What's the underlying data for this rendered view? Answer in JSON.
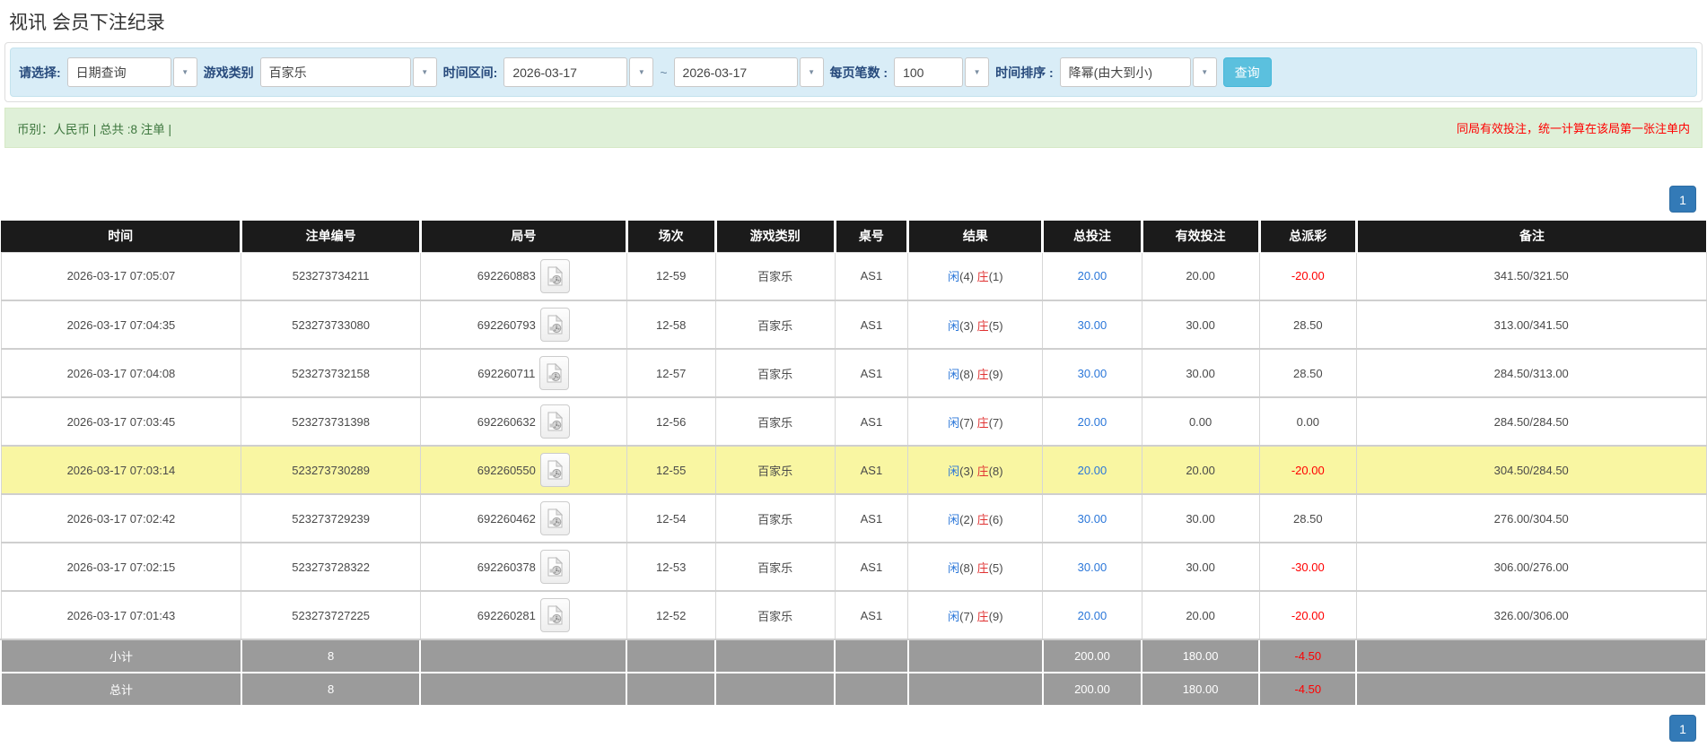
{
  "page": {
    "title": "视讯 会员下注纪录"
  },
  "filters": {
    "select_label": "请选择:",
    "select_value": "日期查询",
    "game_label": "游戏类别",
    "game_value": "百家乐",
    "range_label": "时间区间:",
    "date_from": "2026-03-17",
    "tilde": "~",
    "date_to": "2026-03-17",
    "page_size_label": "每页笔数 :",
    "page_size_value": "100",
    "sort_label": "时间排序 :",
    "sort_value": "降幂(由大到小)",
    "search_button": "查询"
  },
  "summary": {
    "left": "币别：人民币 | 总共 :8 注单 |",
    "right": "同局有效投注，统一计算在该局第一张注单内"
  },
  "pagination": {
    "page": "1"
  },
  "colors": {
    "accent_blue": "#337ab7",
    "link_blue": "#2b77d9",
    "player_blue": "#2b77d9",
    "banker_red": "#e03333",
    "negative_red": "#ff0000",
    "highlight_yellow": "#f9f6a2",
    "filter_bar_bg": "#d9edf7",
    "summary_bar_bg": "#dff0d8",
    "summary_text_green": "#3c763d",
    "table_header_bg": "#1b1b1b",
    "summary_row_gray": "#9b9b9b",
    "search_button_bg": "#5bc0de"
  },
  "icons": {
    "combo_caret": "▼",
    "video_icon": "film-file-icon"
  },
  "table": {
    "headers": [
      "时间",
      "注单编号",
      "局号",
      "场次",
      "游戏类别",
      "桌号",
      "结果",
      "总投注",
      "有效投注",
      "总派彩",
      "备注"
    ],
    "col_widths": [
      "14.1%",
      "10.5%",
      "12.1%",
      "5.2%",
      "7.0%",
      "4.3%",
      "7.9%",
      "5.8%",
      "6.9%",
      "5.7%",
      "20.5%"
    ],
    "rows": [
      {
        "time": "2026-03-17 07:05:07",
        "bet_id": "523273734211",
        "round_id": "692260883",
        "session": "12-59",
        "game": "百家乐",
        "table_no": "AS1",
        "result": {
          "player": "闲(4)",
          "banker": "庄(1)"
        },
        "total_bet": "20.00",
        "valid_bet": "20.00",
        "payout": "-20.00",
        "remark": "341.50/321.50",
        "highlight": false
      },
      {
        "time": "2026-03-17 07:04:35",
        "bet_id": "523273733080",
        "round_id": "692260793",
        "session": "12-58",
        "game": "百家乐",
        "table_no": "AS1",
        "result": {
          "player": "闲(3)",
          "banker": "庄(5)"
        },
        "total_bet": "30.00",
        "valid_bet": "30.00",
        "payout": "28.50",
        "remark": "313.00/341.50",
        "highlight": false
      },
      {
        "time": "2026-03-17 07:04:08",
        "bet_id": "523273732158",
        "round_id": "692260711",
        "session": "12-57",
        "game": "百家乐",
        "table_no": "AS1",
        "result": {
          "player": "闲(8)",
          "banker": "庄(9)"
        },
        "total_bet": "30.00",
        "valid_bet": "30.00",
        "payout": "28.50",
        "remark": "284.50/313.00",
        "highlight": false
      },
      {
        "time": "2026-03-17 07:03:45",
        "bet_id": "523273731398",
        "round_id": "692260632",
        "session": "12-56",
        "game": "百家乐",
        "table_no": "AS1",
        "result": {
          "player": "闲(7)",
          "banker": "庄(7)"
        },
        "total_bet": "20.00",
        "valid_bet": "0.00",
        "payout": "0.00",
        "remark": "284.50/284.50",
        "highlight": false
      },
      {
        "time": "2026-03-17 07:03:14",
        "bet_id": "523273730289",
        "round_id": "692260550",
        "session": "12-55",
        "game": "百家乐",
        "table_no": "AS1",
        "result": {
          "player": "闲(3)",
          "banker": "庄(8)"
        },
        "total_bet": "20.00",
        "valid_bet": "20.00",
        "payout": "-20.00",
        "remark": "304.50/284.50",
        "highlight": true
      },
      {
        "time": "2026-03-17 07:02:42",
        "bet_id": "523273729239",
        "round_id": "692260462",
        "session": "12-54",
        "game": "百家乐",
        "table_no": "AS1",
        "result": {
          "player": "闲(2)",
          "banker": "庄(6)"
        },
        "total_bet": "30.00",
        "valid_bet": "30.00",
        "payout": "28.50",
        "remark": "276.00/304.50",
        "highlight": false
      },
      {
        "time": "2026-03-17 07:02:15",
        "bet_id": "523273728322",
        "round_id": "692260378",
        "session": "12-53",
        "game": "百家乐",
        "table_no": "AS1",
        "result": {
          "player": "闲(8)",
          "banker": "庄(5)"
        },
        "total_bet": "30.00",
        "valid_bet": "30.00",
        "payout": "-30.00",
        "remark": "306.00/276.00",
        "highlight": false
      },
      {
        "time": "2026-03-17 07:01:43",
        "bet_id": "523273727225",
        "round_id": "692260281",
        "session": "12-52",
        "game": "百家乐",
        "table_no": "AS1",
        "result": {
          "player": "闲(7)",
          "banker": "庄(9)"
        },
        "total_bet": "20.00",
        "valid_bet": "20.00",
        "payout": "-20.00",
        "remark": "326.00/306.00",
        "highlight": false
      }
    ],
    "footer": [
      {
        "label": "小计",
        "count": "8",
        "total_bet": "200.00",
        "valid_bet": "180.00",
        "payout": "-4.50"
      },
      {
        "label": "总计",
        "count": "8",
        "total_bet": "200.00",
        "valid_bet": "180.00",
        "payout": "-4.50"
      }
    ]
  }
}
